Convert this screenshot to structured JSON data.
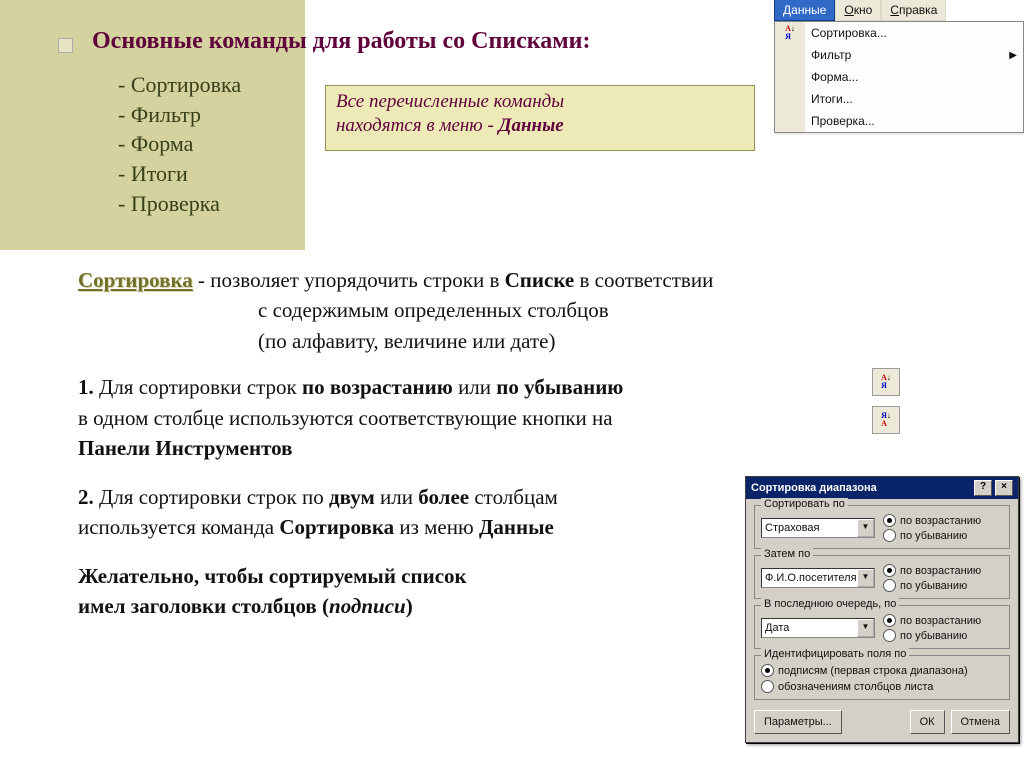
{
  "title": "Основные команды для работы со Списками:",
  "commands": [
    "- Сортировка",
    "- Фильтр",
    "- Форма",
    "- Итоги",
    "- Проверка"
  ],
  "note": {
    "line1": "Все перечисленные команды",
    "line2_a": "находятся в меню - ",
    "line2_b": "Данные"
  },
  "menu": {
    "bar": {
      "active": "Данные",
      "items": [
        "Окно",
        "Справка"
      ]
    },
    "rows": [
      "Сортировка...",
      "Фильтр",
      "Форма...",
      "Итоги...",
      "Проверка..."
    ],
    "submenu_idx": 1
  },
  "content": {
    "sort_word": "Сортировка",
    "desc1": " - позволяет упорядочить строки в ",
    "desc1b": "Списке",
    "desc1c": " в соответствии",
    "desc2": "с содержимым   определенных столбцов",
    "desc3": "(по алфавиту, величине или дате)",
    "p1a": "1.",
    "p1b": " Для сортировки строк ",
    "p1c": "по возрастанию",
    "p1d": " или ",
    "p1e": "по убыванию",
    "p2": "в одном столбце используются соответствующие кнопки на",
    "p3": " Панели Инструментов",
    "p4a": "2.",
    "p4b": " Для сортировки строк по ",
    "p4c": "двум",
    "p4d": " или ",
    "p4e": "более",
    "p4f": " столбцам",
    "p5a": "используется команда ",
    "p5b": "Сортировка",
    "p5c": " из меню ",
    "p5d": "Данные",
    "p6": "Желательно, чтобы сортируемый список",
    "p7a": "имел заголовки столбцов (",
    "p7b": "подписи",
    "p7c": ")"
  },
  "dialog": {
    "title": "Сортировка диапазона",
    "g1": {
      "label": "Сортировать по",
      "value": "Страховая",
      "asc": "по возрастанию",
      "desc": "по убыванию",
      "sel": "asc"
    },
    "g2": {
      "label": "Затем по",
      "value": "Ф.И.О.посетителя",
      "asc": "по возрастанию",
      "desc": "по убыванию",
      "sel": "asc"
    },
    "g3": {
      "label": "В последнюю очередь, по",
      "value": "Дата",
      "asc": "по возрастанию",
      "desc": "по убыванию",
      "sel": "asc"
    },
    "g4": {
      "label": "Идентифицировать поля по",
      "opt1": "подписям (первая строка диапазона)",
      "opt2": "обозначениям столбцов листа",
      "sel": "opt1"
    },
    "buttons": {
      "params": "Параметры...",
      "ok": "ОК",
      "cancel": "Отмена"
    }
  }
}
